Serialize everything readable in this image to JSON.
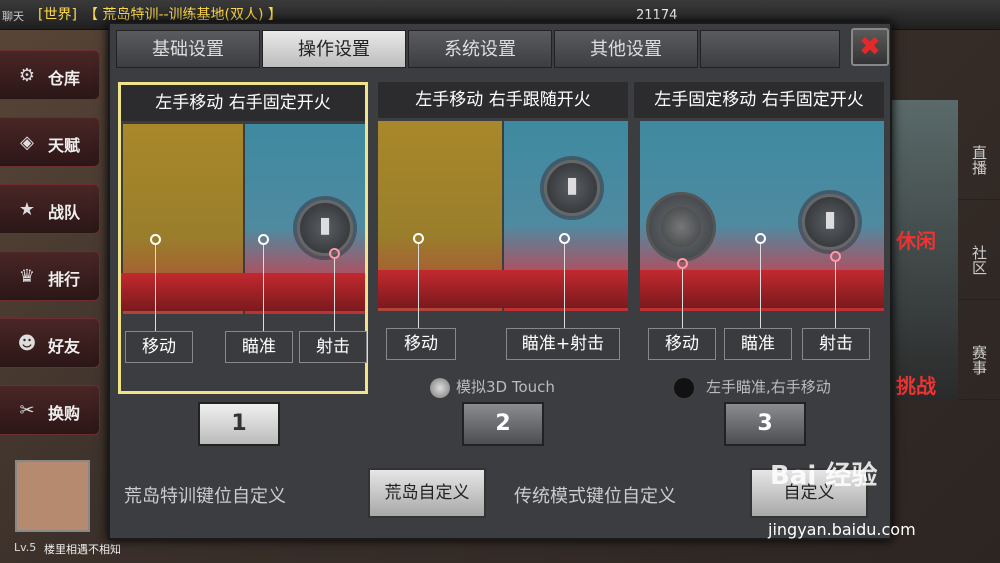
{
  "topbar": {
    "chat_label": "聊天",
    "channel": "[世界]",
    "room": "【 荒岛特训--训练基地(双人) 】",
    "coin_value": "21174"
  },
  "left_menu": [
    {
      "label": "仓库",
      "icon": "warehouse-icon",
      "glyph": "⚙"
    },
    {
      "label": "天赋",
      "icon": "talent-icon",
      "glyph": "◈"
    },
    {
      "label": "战队",
      "icon": "team-icon",
      "glyph": "★"
    },
    {
      "label": "排行",
      "icon": "ranking-icon",
      "glyph": "♛"
    },
    {
      "label": "好友",
      "icon": "friends-icon",
      "glyph": "☻"
    },
    {
      "label": "换购",
      "icon": "exchange-icon",
      "glyph": "✂"
    }
  ],
  "player": {
    "level": "Lv.5",
    "name": "楼里相遇不相知"
  },
  "right_col": [
    "直播",
    "社区",
    "赛事"
  ],
  "promo": {
    "line1": "休闲",
    "line2": "挑战"
  },
  "dialog": {
    "tabs": [
      "基础设置",
      "操作设置",
      "系统设置",
      "其他设置"
    ],
    "active_tab": "操作设置",
    "close_glyph": "✖",
    "panels": [
      {
        "title": "左手移动 右手固定开火",
        "labels": [
          "移动",
          "瞄准",
          "射击"
        ]
      },
      {
        "title": "左手移动 右手跟随开火",
        "labels": [
          "移动",
          "瞄准+射击"
        ],
        "option": "模拟3D Touch"
      },
      {
        "title": "左手固定移动 右手固定开火",
        "labels": [
          "移动",
          "瞄准",
          "射击"
        ],
        "option": "左手瞄准,右手移动"
      }
    ],
    "numbers": [
      "1",
      "2",
      "3"
    ],
    "selected_number": "1",
    "footer": {
      "island_label": "荒岛特训键位自定义",
      "island_button": "荒岛自定义",
      "classic_label": "传统模式键位自定义",
      "classic_button": "自定义"
    }
  },
  "watermark": {
    "brand": "Bai 经验",
    "url": "jingyan.baidu.com"
  }
}
